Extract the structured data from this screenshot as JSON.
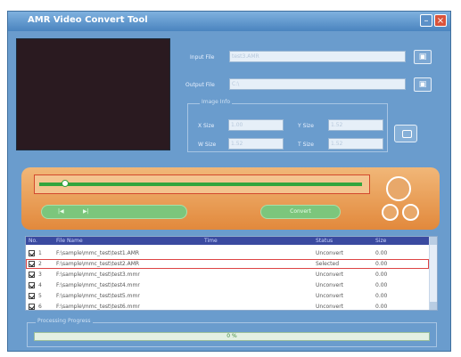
{
  "window": {
    "title": "AMR Video Convert Tool",
    "min_glyph": "–",
    "close_glyph": "×"
  },
  "input": {
    "label": "Input File",
    "value": "test3.AMR",
    "browse_icon": "folder-icon"
  },
  "output": {
    "label": "Output File",
    "value": "C:\\",
    "browse_icon": "folder-icon"
  },
  "image_info": {
    "legend": "Image Info",
    "x_label": "X Size",
    "x_value": "1.00",
    "y_label": "Y Size",
    "y_value": "1.52",
    "w_label": "W Size",
    "w_value": "1.52",
    "t_label": "T Size",
    "t_value": "1.52",
    "camera_icon": "camera-icon"
  },
  "player": {
    "prev_label": "|◀",
    "next_label": "▶|",
    "convert_label": "Convert",
    "seek_fraction": 0.08
  },
  "table": {
    "headers": [
      "No.",
      "File Name",
      "Time",
      "Status",
      "Size"
    ],
    "rows": [
      {
        "no": "1",
        "name": "F:\\sample\\mmc_test\\test1.AMR",
        "status": "Unconvert",
        "size": "0.00"
      },
      {
        "no": "2",
        "name": "F:\\sample\\mmc_test\\test2.AMR",
        "status": "Selected",
        "size": "0.00",
        "selected": true
      },
      {
        "no": "3",
        "name": "F:\\sample\\mmc_test\\test3.mmr",
        "status": "Unconvert",
        "size": "0.00"
      },
      {
        "no": "4",
        "name": "F:\\sample\\mmc_test\\test4.mmr",
        "status": "Unconvert",
        "size": "0.00"
      },
      {
        "no": "5",
        "name": "F:\\sample\\mmc_test\\test5.mmr",
        "status": "Unconvert",
        "size": "0.00"
      },
      {
        "no": "6",
        "name": "F:\\sample\\mmc_test\\test6.mmr",
        "status": "Unconvert",
        "size": "0.00"
      }
    ]
  },
  "progress": {
    "legend": "Processing Progress",
    "text": "0 %",
    "fraction": 0
  }
}
